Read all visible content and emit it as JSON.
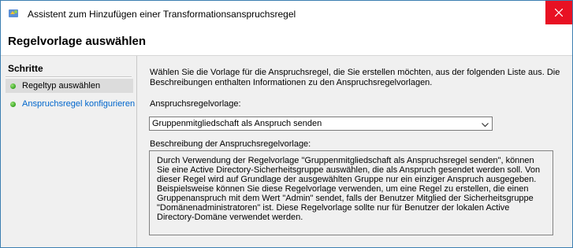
{
  "window": {
    "title": "Assistent zum Hinzufügen einer Transformationsanspruchsregel"
  },
  "header": {
    "title": "Regelvorlage auswählen"
  },
  "sidebar": {
    "heading": "Schritte",
    "items": [
      {
        "label": "Regeltyp auswählen"
      },
      {
        "label": "Anspruchsregel konfigurieren"
      }
    ]
  },
  "main": {
    "intro": "Wählen Sie die Vorlage für die Anspruchsregel, die Sie erstellen möchten, aus der folgenden Liste aus. Die Beschreibungen enthalten Informationen zu den Anspruchsregelvorlagen.",
    "template_label": "Anspruchsregelvorlage:",
    "template_value": "Gruppenmitgliedschaft als Anspruch senden",
    "description_label": "Beschreibung der Anspruchsregelvorlage:",
    "description": "Durch Verwendung der Regelvorlage \"Gruppenmitgliedschaft als Anspruchsregel senden\", können Sie eine Active Directory-Sicherheitsgruppe auswählen, die als Anspruch gesendet werden soll. Von dieser Regel wird auf Grundlage der ausgewählten Gruppe nur ein einziger Anspruch ausgegeben. Beispielsweise können Sie diese Regelvorlage verwenden, um eine Regel zu erstellen, die einen Gruppenanspruch mit dem Wert \"Admin\" sendet, falls der Benutzer Mitglied der Sicherheitsgruppe \"Domänenadministratoren\" ist.  Diese Regelvorlage sollte nur für Benutzer der lokalen Active Directory-Domäne verwendet werden."
  }
}
